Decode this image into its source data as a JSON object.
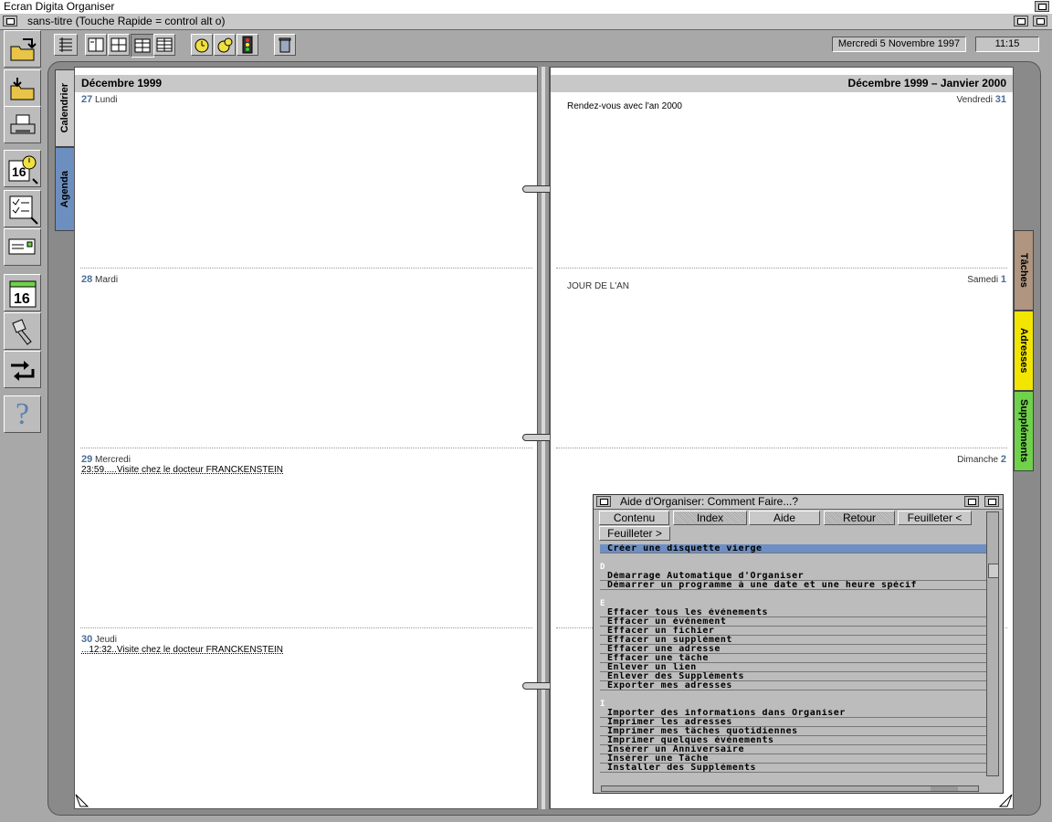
{
  "window": {
    "app_title": "Ecran Digita Organiser",
    "doc_title": "sans-titre  (Touche Rapide = control alt o)"
  },
  "toolbar": {
    "date": "Mercredi 5 Novembre 1997",
    "time": "11:15"
  },
  "left_page": {
    "header": "Décembre 1999",
    "days": [
      {
        "num": "27",
        "name": "Lundi",
        "events": []
      },
      {
        "num": "28",
        "name": "Mardi",
        "events": []
      },
      {
        "num": "29",
        "name": "Mercredi",
        "events": [
          "23:59.....Visite chez le docteur FRANCKENSTEIN"
        ]
      },
      {
        "num": "30",
        "name": "Jeudi",
        "events": [
          "...12:32..Visite chez le docteur FRANCKENSTEIN"
        ]
      }
    ]
  },
  "right_page": {
    "header": "Décembre 1999 – Janvier 2000",
    "days": [
      {
        "num": "31",
        "name": "Vendredi",
        "events": [
          "Rendez-vous avec l'an 2000"
        ]
      },
      {
        "num": "1",
        "name": "Samedi",
        "events": [
          "JOUR DE L'AN"
        ]
      },
      {
        "num": "2",
        "name": "Dimanche",
        "events": []
      }
    ]
  },
  "left_tabs": {
    "calendrier": "Calendrier",
    "agenda": "Agenda"
  },
  "right_tabs": {
    "taches": "Tâches",
    "adresses": "Adresses",
    "supplements": "Suppléments"
  },
  "help": {
    "title": "Aide d'Organiser: Comment Faire...?",
    "buttons": {
      "contenu": "Contenu",
      "index": "Index",
      "aide": "Aide",
      "retour": "Retour",
      "feuilleter_prev": "Feuilleter <",
      "feuilleter_next": "Feuilleter >"
    },
    "letters": {
      "d": "D",
      "e": "E",
      "i": "I"
    },
    "items": [
      "Créer une disquette vierge",
      "Démarrage Automatique d'Organiser",
      "Démarrer un programme à une date et une heure spécif",
      "Effacer tous les événements",
      "Effacer un événement",
      "Effacer un fichier",
      "Effacer un supplément",
      "Effacer une adresse",
      "Effacer une tâche",
      "Enlever un lien",
      "Enlever des Suppléments",
      "Exporter mes adresses",
      "Importer des informations dans Organiser",
      "Imprimer les adresses",
      "Imprimer mes tâches quotidiennes",
      "Imprimer quelques événements",
      "Insérer un Anniversaire",
      "Insérer une Tâche",
      "Installer des Suppléments"
    ]
  },
  "colors": {
    "accent": "#4a6d99",
    "selection": "#6e8fc4",
    "tab_taches": "#b09580",
    "tab_adresses": "#f2e600",
    "tab_supplements": "#6fd24a",
    "tab_agenda": "#6d8fc0"
  }
}
